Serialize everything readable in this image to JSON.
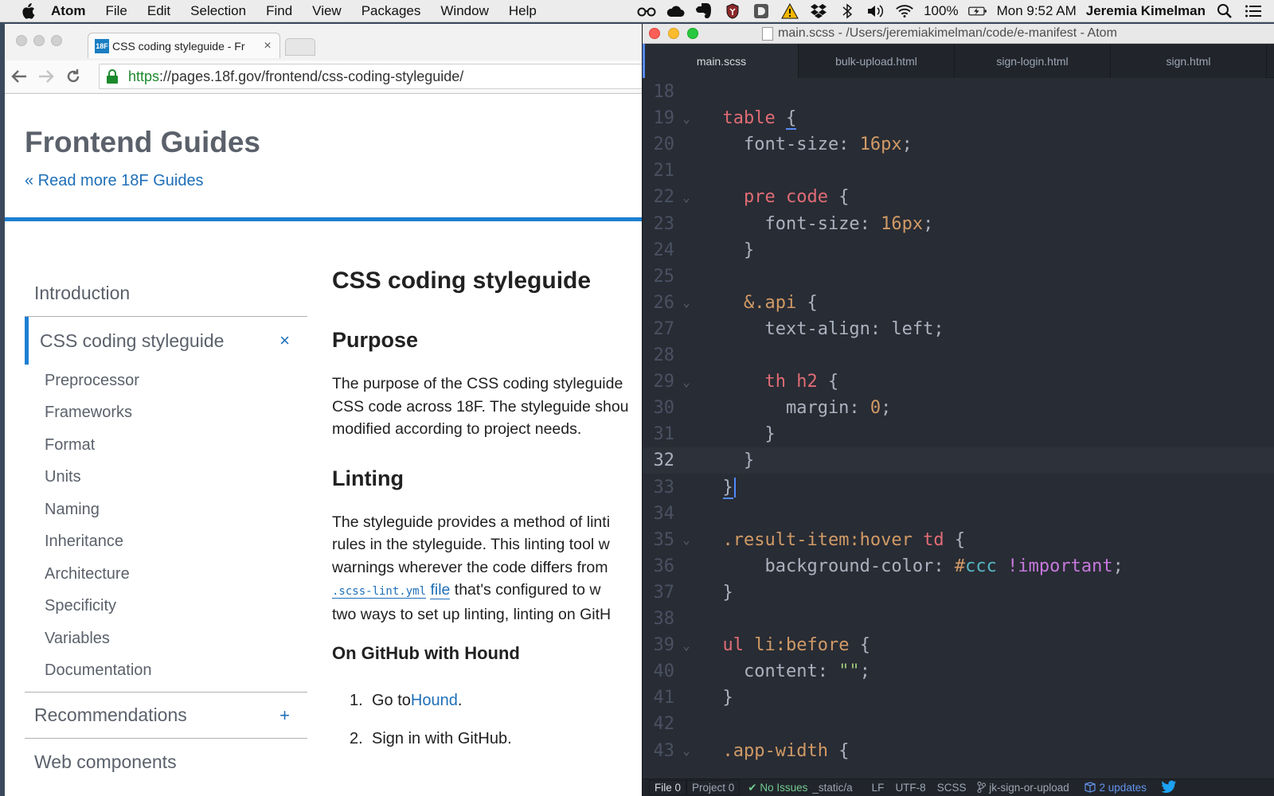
{
  "menubar": {
    "items": [
      "Atom",
      "File",
      "Edit",
      "Selection",
      "Find",
      "View",
      "Packages",
      "Window",
      "Help"
    ],
    "battery": "100%",
    "clock": "Mon 9:52 AM",
    "user": "Jeremia Kimelman"
  },
  "browser": {
    "tab_title": "CSS coding styleguide - Fr",
    "favicon_text": "18F",
    "url_scheme": "https",
    "url_rest": "://pages.18f.gov/frontend/css-coding-styleguide/",
    "site_title": "Frontend Guides",
    "read_more": "« Read more 18F Guides",
    "sidenav": {
      "introduction": "Introduction",
      "current": "CSS coding styleguide",
      "current_btn": "×",
      "subitems": [
        "Preprocessor",
        "Frameworks",
        "Format",
        "Units",
        "Naming",
        "Inheritance",
        "Architecture",
        "Specificity",
        "Variables",
        "Documentation"
      ],
      "recommendations": "Recommendations",
      "recommendations_btn": "+",
      "web_components": "Web components"
    },
    "content": {
      "h1": "CSS coding styleguide",
      "purpose_heading": "Purpose",
      "purpose_lines": [
        "The purpose of the CSS coding styleguide",
        "CSS code across 18F. The styleguide shou",
        "modified according to project needs."
      ],
      "linting_heading": "Linting",
      "linting_lines": [
        "The styleguide provides a method of linti",
        "rules in the styleguide. This linting tool w",
        "warnings wherever the code differs from"
      ],
      "linting_code": ".scss-lint.yml",
      "linting_link": "file",
      "linting_after_link": " that's configured to w",
      "linting_last": "two ways to set up linting, linting on GitH",
      "hound_heading": "On GitHub with Hound",
      "steps": [
        {
          "num": "1.",
          "before": "Go to ",
          "link": "Hound",
          "after": "."
        },
        {
          "num": "2.",
          "before": "Sign in with GitHub.",
          "link": "",
          "after": ""
        }
      ]
    }
  },
  "atom": {
    "title": "main.scss - /Users/jeremiakimelman/code/e-manifest - Atom",
    "tabs": [
      "main.scss",
      "bulk-upload.html",
      "sign-login.html",
      "sign.html"
    ],
    "active_tab": 0,
    "current_line": 32,
    "lines": [
      {
        "n": "18",
        "fold": false,
        "tokens": []
      },
      {
        "n": "19",
        "fold": true,
        "tokens": [
          [
            "  ",
            ""
          ],
          [
            "table",
            "tag"
          ],
          [
            " ",
            ""
          ],
          [
            "{",
            "br"
          ]
        ]
      },
      {
        "n": "20",
        "fold": false,
        "tokens": [
          [
            "    font-size: ",
            ""
          ],
          [
            "16px",
            "num"
          ],
          [
            ";",
            ""
          ]
        ]
      },
      {
        "n": "21",
        "fold": false,
        "tokens": []
      },
      {
        "n": "22",
        "fold": true,
        "tokens": [
          [
            "    ",
            ""
          ],
          [
            "pre code",
            "tag"
          ],
          [
            " {",
            ""
          ]
        ]
      },
      {
        "n": "23",
        "fold": false,
        "tokens": [
          [
            "      font-size: ",
            ""
          ],
          [
            "16px",
            "num"
          ],
          [
            ";",
            ""
          ]
        ]
      },
      {
        "n": "24",
        "fold": false,
        "tokens": [
          [
            "    }",
            ""
          ]
        ]
      },
      {
        "n": "25",
        "fold": false,
        "tokens": []
      },
      {
        "n": "26",
        "fold": true,
        "tokens": [
          [
            "    ",
            ""
          ],
          [
            "&.api",
            "cls"
          ],
          [
            " {",
            ""
          ]
        ]
      },
      {
        "n": "27",
        "fold": false,
        "tokens": [
          [
            "      text-align: left;",
            ""
          ]
        ]
      },
      {
        "n": "28",
        "fold": false,
        "tokens": []
      },
      {
        "n": "29",
        "fold": true,
        "tokens": [
          [
            "      ",
            ""
          ],
          [
            "th h2",
            "tag"
          ],
          [
            " {",
            ""
          ]
        ]
      },
      {
        "n": "30",
        "fold": false,
        "tokens": [
          [
            "        margin: ",
            ""
          ],
          [
            "0",
            "num"
          ],
          [
            ";",
            ""
          ]
        ]
      },
      {
        "n": "31",
        "fold": false,
        "tokens": [
          [
            "      }",
            ""
          ]
        ]
      },
      {
        "n": "32",
        "fold": false,
        "tokens": [
          [
            "    }",
            ""
          ]
        ]
      },
      {
        "n": "33",
        "fold": false,
        "tokens": [
          [
            "  ",
            ""
          ],
          [
            "}",
            "br"
          ],
          [
            "",
            "cursor"
          ]
        ]
      },
      {
        "n": "34",
        "fold": false,
        "tokens": []
      },
      {
        "n": "35",
        "fold": true,
        "tokens": [
          [
            "  ",
            ""
          ],
          [
            ".result-item:hover",
            "cls"
          ],
          [
            " ",
            ""
          ],
          [
            "td",
            "tag"
          ],
          [
            " {",
            ""
          ]
        ]
      },
      {
        "n": "36",
        "fold": false,
        "tokens": [
          [
            "      background-color: ",
            ""
          ],
          [
            "#",
            "cls"
          ],
          [
            "ccc",
            "hex"
          ],
          [
            " ",
            ""
          ],
          [
            "!important",
            "kw"
          ],
          [
            ";",
            ""
          ]
        ]
      },
      {
        "n": "37",
        "fold": false,
        "tokens": [
          [
            "  }",
            ""
          ]
        ]
      },
      {
        "n": "38",
        "fold": false,
        "tokens": []
      },
      {
        "n": "39",
        "fold": true,
        "tokens": [
          [
            "  ",
            ""
          ],
          [
            "ul",
            "tag"
          ],
          [
            " ",
            ""
          ],
          [
            "li:before",
            "cls"
          ],
          [
            " {",
            ""
          ]
        ]
      },
      {
        "n": "40",
        "fold": false,
        "tokens": [
          [
            "    content: ",
            ""
          ],
          [
            "\"\"",
            "str"
          ],
          [
            ";",
            ""
          ]
        ]
      },
      {
        "n": "41",
        "fold": false,
        "tokens": [
          [
            "  }",
            ""
          ]
        ]
      },
      {
        "n": "42",
        "fold": false,
        "tokens": []
      },
      {
        "n": "43",
        "fold": true,
        "tokens": [
          [
            "  ",
            ""
          ],
          [
            ".app-width",
            "cls"
          ],
          [
            " {",
            ""
          ]
        ]
      }
    ],
    "status": {
      "file": "File  0",
      "project": "Project  0",
      "issues": "✔ No Issues",
      "path": "_static/a",
      "line_ending": "LF",
      "encoding": "UTF-8",
      "grammar": "SCSS",
      "branch": "jk-sign-or-upload",
      "updates": "2 updates"
    }
  },
  "colors": {
    "link_blue": "#1e6fb8",
    "rule_blue": "#1e7fd3",
    "atom_bg": "#282c34"
  }
}
